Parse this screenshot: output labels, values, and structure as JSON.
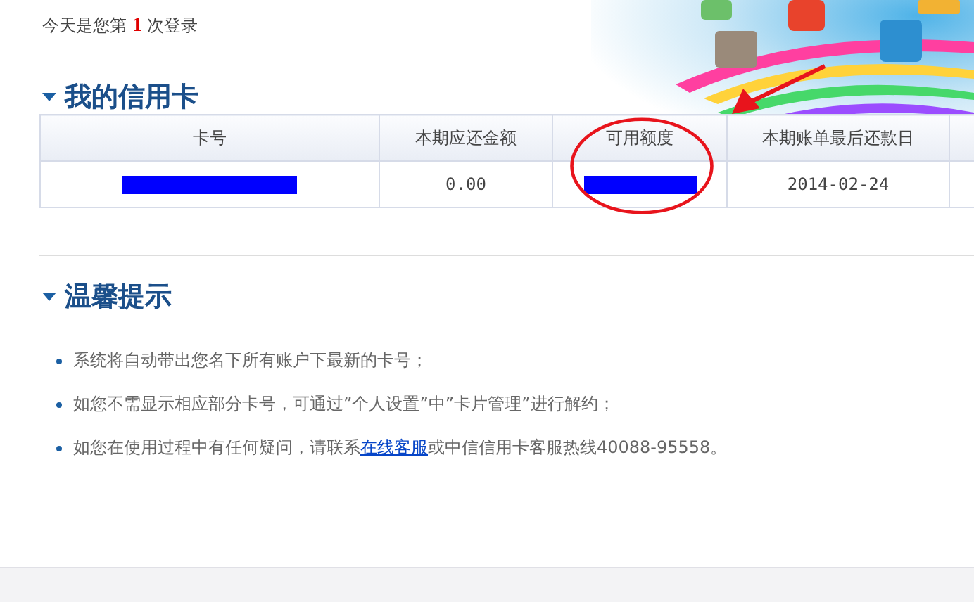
{
  "login_notice": {
    "prefix": "今天是您第",
    "count": "1",
    "suffix": "次登录"
  },
  "cards_section": {
    "title": "我的信用卡",
    "columns": [
      "卡号",
      "本期应还金额",
      "可用额度",
      "本期账单最后还款日"
    ],
    "rows": [
      {
        "cells": [
          {
            "kind": "redacted"
          },
          {
            "kind": "text",
            "text": "0.00"
          },
          {
            "kind": "redacted"
          },
          {
            "kind": "text",
            "text": "2014-02-24"
          }
        ]
      }
    ]
  },
  "annotation": {
    "kind": "circle-and-arrow"
  },
  "tips_section": {
    "title": "温馨提示",
    "items": [
      {
        "text": "系统将自动带出您名下所有账户下最新的卡号；"
      },
      {
        "text": "如您不需显示相应部分卡号，可通过”个人设置”中”卡片管理”进行解约；"
      },
      {
        "text": "如您在使用过程中有任何疑问，请联系",
        "link": "在线客服",
        "text_after": "或中信信用卡客服热线40088-95558。"
      }
    ]
  }
}
